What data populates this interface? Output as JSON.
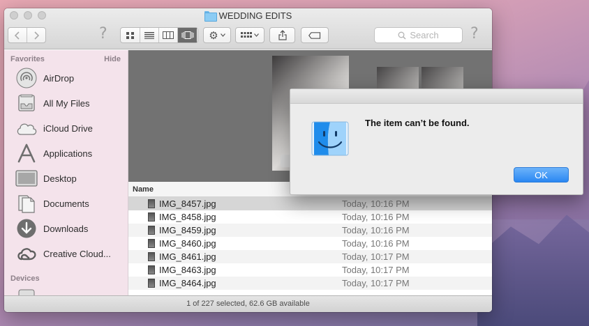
{
  "window": {
    "title": "WEDDING EDITS",
    "status": "1 of 227 selected, 62.6 GB available"
  },
  "toolbar": {
    "search_placeholder": "Search"
  },
  "sidebar": {
    "favorites_label": "Favorites",
    "hide_label": "Hide",
    "items": [
      {
        "label": "AirDrop",
        "icon": "airdrop-icon"
      },
      {
        "label": "All My Files",
        "icon": "all-files-icon"
      },
      {
        "label": "iCloud Drive",
        "icon": "cloud-icon"
      },
      {
        "label": "Applications",
        "icon": "applications-icon"
      },
      {
        "label": "Desktop",
        "icon": "desktop-icon"
      },
      {
        "label": "Documents",
        "icon": "documents-icon"
      },
      {
        "label": "Downloads",
        "icon": "downloads-icon"
      },
      {
        "label": "Creative Cloud...",
        "icon": "creative-cloud-icon"
      }
    ],
    "devices_label": "Devices"
  },
  "list": {
    "name_header": "Name",
    "rows": [
      {
        "name": "IMG_8457.jpg",
        "date": "Today, 10:16 PM"
      },
      {
        "name": "IMG_8458.jpg",
        "date": "Today, 10:16 PM"
      },
      {
        "name": "IMG_8459.jpg",
        "date": "Today, 10:16 PM"
      },
      {
        "name": "IMG_8460.jpg",
        "date": "Today, 10:16 PM"
      },
      {
        "name": "IMG_8461.jpg",
        "date": "Today, 10:17 PM"
      },
      {
        "name": "IMG_8463.jpg",
        "date": "Today, 10:17 PM"
      },
      {
        "name": "IMG_8464.jpg",
        "date": "Today, 10:17 PM"
      }
    ]
  },
  "alert": {
    "message": "The item can’t be found.",
    "ok_label": "OK"
  }
}
